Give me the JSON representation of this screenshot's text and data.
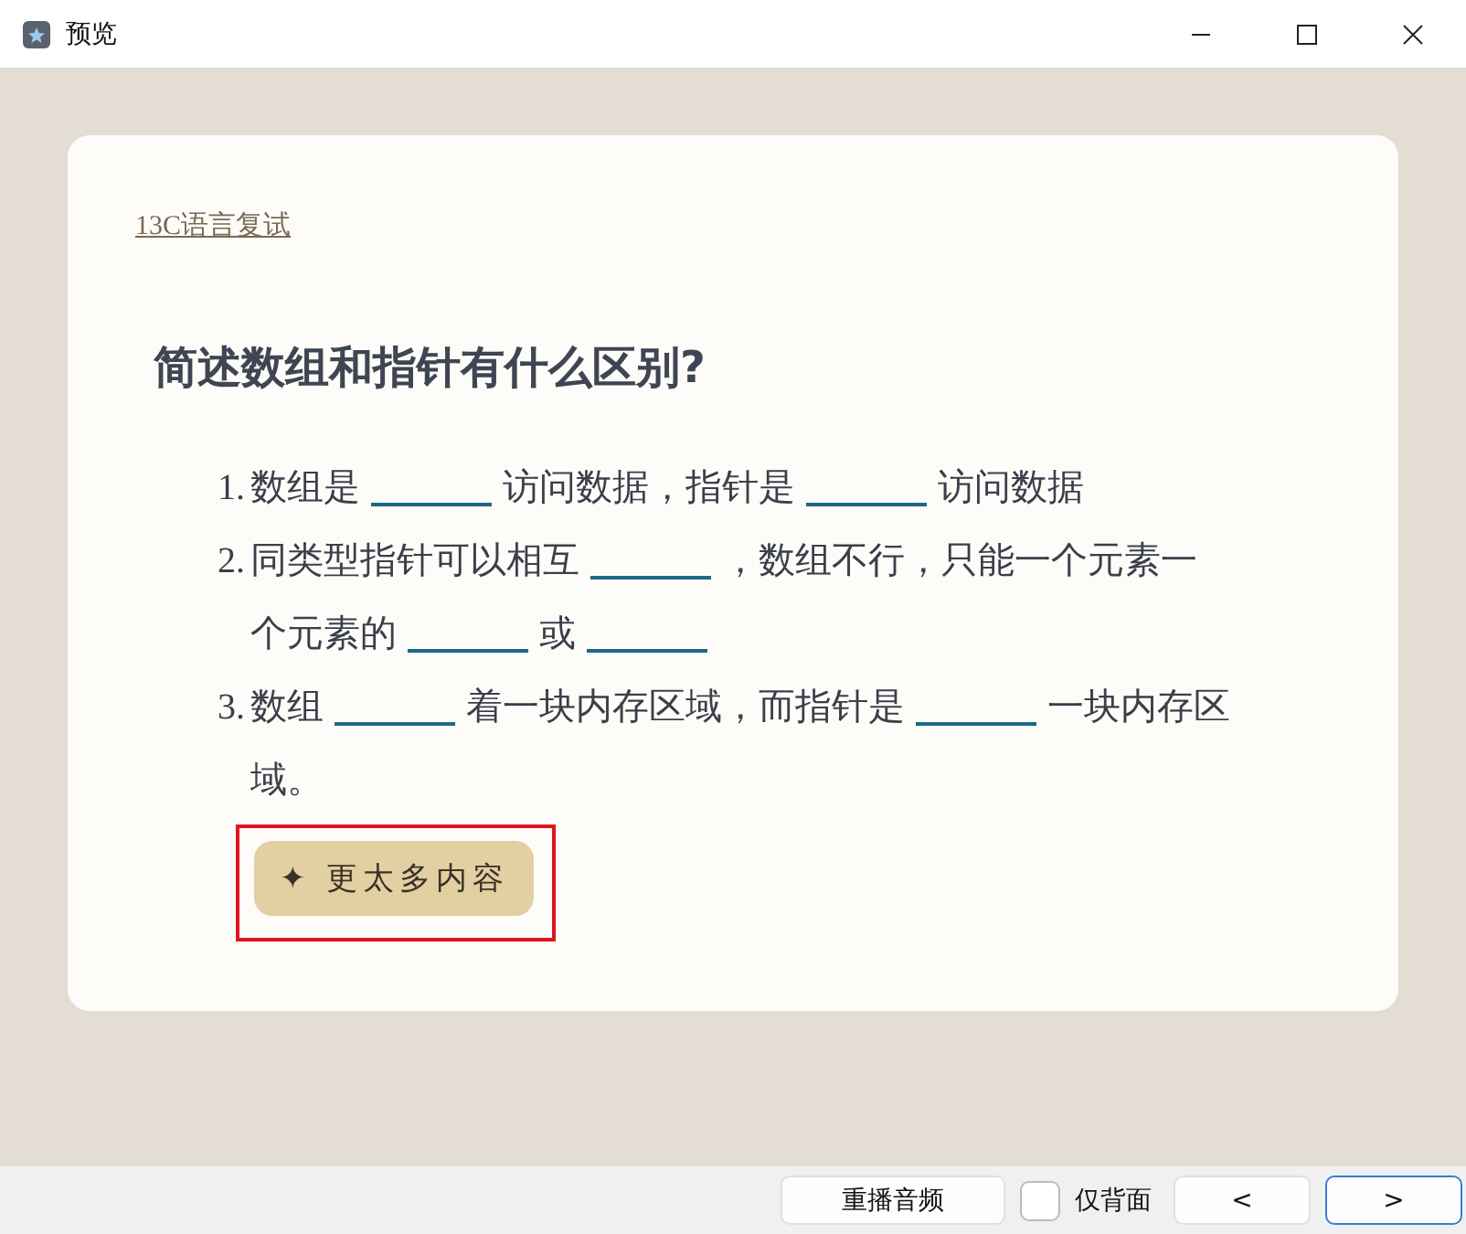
{
  "window": {
    "title": "预览"
  },
  "card": {
    "deck_link": "13C语言复试",
    "question": "简述数组和指针有什么区别?",
    "items": [
      {
        "number": "1.",
        "lines": [
          [
            {
              "kind": "text",
              "text": "数组是"
            },
            {
              "kind": "blank"
            },
            {
              "kind": "text",
              "text": "访问数据，指针是"
            },
            {
              "kind": "blank"
            },
            {
              "kind": "text",
              "text": "访问数据"
            }
          ]
        ]
      },
      {
        "number": "2.",
        "lines": [
          [
            {
              "kind": "text",
              "text": "同类型指针可以相互"
            },
            {
              "kind": "blank"
            },
            {
              "kind": "text",
              "text": "，数组不行，只能一个元素一"
            }
          ],
          [
            {
              "kind": "text",
              "text": "个元素的"
            },
            {
              "kind": "blank"
            },
            {
              "kind": "text",
              "text": "或"
            },
            {
              "kind": "blank"
            }
          ]
        ]
      },
      {
        "number": "3.",
        "lines": [
          [
            {
              "kind": "text",
              "text": "数组"
            },
            {
              "kind": "blank"
            },
            {
              "kind": "text",
              "text": "着一块内存区域，而指针是"
            },
            {
              "kind": "blank"
            },
            {
              "kind": "text",
              "text": "一块内存区"
            }
          ],
          [
            {
              "kind": "text",
              "text": "域。"
            }
          ]
        ]
      }
    ],
    "more_button": {
      "icon": "✦",
      "label": "更太多内容",
      "highlighted": true
    }
  },
  "bottom_bar": {
    "replay": "重播音频",
    "back_only": {
      "label": "仅背面",
      "checked": false
    },
    "prev": "<",
    "next": ">"
  }
}
